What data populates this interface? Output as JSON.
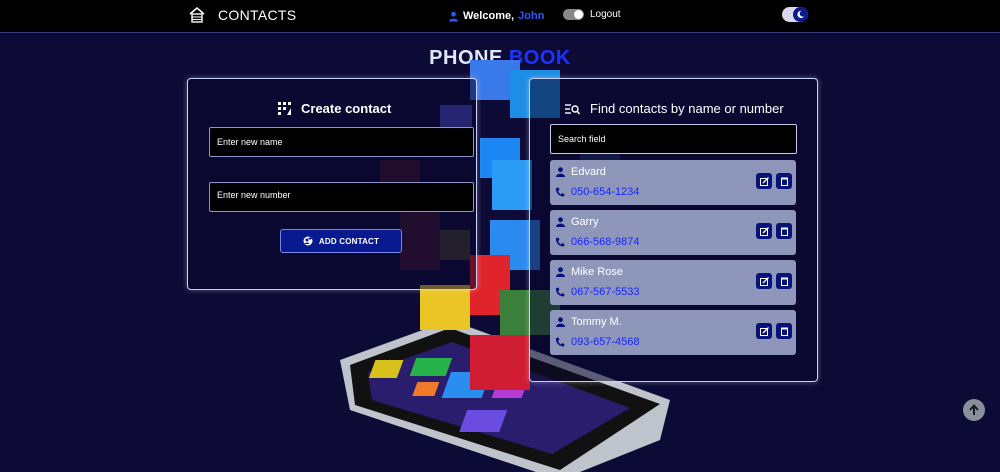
{
  "header": {
    "brand_title": "CONTACTS",
    "welcome_label": "Welcome,",
    "user_name": "John",
    "logout_label": "Logout"
  },
  "page_title_part1": "PHONE",
  "page_title_part2": "BOOK",
  "create": {
    "title": "Create contact",
    "name_placeholder": "Enter new name",
    "number_placeholder": "Enter new number",
    "add_button_label": "ADD CONTACT"
  },
  "find": {
    "title": "Find contacts by name or number",
    "search_placeholder": "Search field"
  },
  "contacts": [
    {
      "name": "Edvard",
      "number": "050-654-1234"
    },
    {
      "name": "Garry",
      "number": "066-568-9874"
    },
    {
      "name": "Mike Rose",
      "number": "067-567-5533"
    },
    {
      "name": "Tommy M.",
      "number": "093-657-4568"
    }
  ],
  "colors": {
    "background": "#0d0a36",
    "accent": "#091a91",
    "link_blue": "#1826ff",
    "card": "#8e97b9"
  }
}
